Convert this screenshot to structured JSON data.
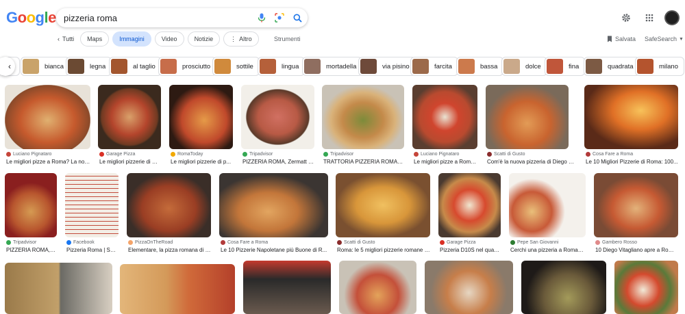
{
  "search": {
    "query": "pizzeria roma"
  },
  "nav": {
    "back": "Tutti",
    "tabs": [
      {
        "label": "Maps"
      },
      {
        "label": "Immagini"
      },
      {
        "label": "Video"
      },
      {
        "label": "Notizie"
      },
      {
        "label": "Altro"
      }
    ],
    "tools": "Strumenti",
    "saved": "Salvata",
    "safesearch": "SafeSearch"
  },
  "chips": [
    {
      "label": "n"
    },
    {
      "label": "bianca"
    },
    {
      "label": "legna"
    },
    {
      "label": "al taglio"
    },
    {
      "label": "prosciutto"
    },
    {
      "label": "sottile"
    },
    {
      "label": "lingua"
    },
    {
      "label": "mortadella"
    },
    {
      "label": "via pisino"
    },
    {
      "label": "farcita"
    },
    {
      "label": "bassa"
    },
    {
      "label": "dolce"
    },
    {
      "label": "fina"
    },
    {
      "label": "quadrata"
    },
    {
      "label": "milano"
    }
  ],
  "results_row1": [
    {
      "source": "Luciano Pignataro",
      "caption": "Le migliori pizze a Roma? La nost..."
    },
    {
      "source": "Garage Pizza",
      "caption": "Le migliori pizzerie di Ro..."
    },
    {
      "source": "RomaToday",
      "caption": "Le migliori pizzerie di p..."
    },
    {
      "source": "Tripadvisor",
      "caption": "PIZZERIA ROMA, Zermatt - ..."
    },
    {
      "source": "Tripadvisor",
      "caption": "TRATTORIA PIZZERIA ROMA, Lu..."
    },
    {
      "source": "Luciano Pignataro",
      "caption": "Le migliori pizze a Roma..."
    },
    {
      "source": "Scatti di Gusto",
      "caption": "Com'è la nuova pizzeria di Diego Vita..."
    },
    {
      "source": "Cosa Fare a Roma",
      "caption": "Le 10 Migliori Pizzerie di Roma: 100..."
    }
  ],
  "results_row2": [
    {
      "source": "Tripadvisor",
      "caption": "PIZZERIA ROMA, VI..."
    },
    {
      "source": "Facebook",
      "caption": "Pizzeria Roma | San ..."
    },
    {
      "source": "PizzaOnTheRoad",
      "caption": "Elementare, la pizza romana di Mi..."
    },
    {
      "source": "Cosa Fare a Roma",
      "caption": "Le 10 Pizzerie Napoletane più Buone di R..."
    },
    {
      "source": "Scatti di Gusto",
      "caption": "Roma: le 5 migliori pizzerie romane ch..."
    },
    {
      "source": "Garage Pizza",
      "caption": "Pizzeria D10S nel quarti..."
    },
    {
      "source": "Pepe San Giovanni",
      "caption": "Cerchi una pizzeria a Roma? A..."
    },
    {
      "source": "Gambero Rosso",
      "caption": "10 Diego Vitagliano apre a Roma..."
    }
  ],
  "colors": {
    "accent": "#0b57d0",
    "active_tab_bg": "#d3e3fd",
    "google_blue": "#4285f4",
    "google_red": "#ea4335",
    "google_yellow": "#fbbc05",
    "google_green": "#34a853"
  }
}
